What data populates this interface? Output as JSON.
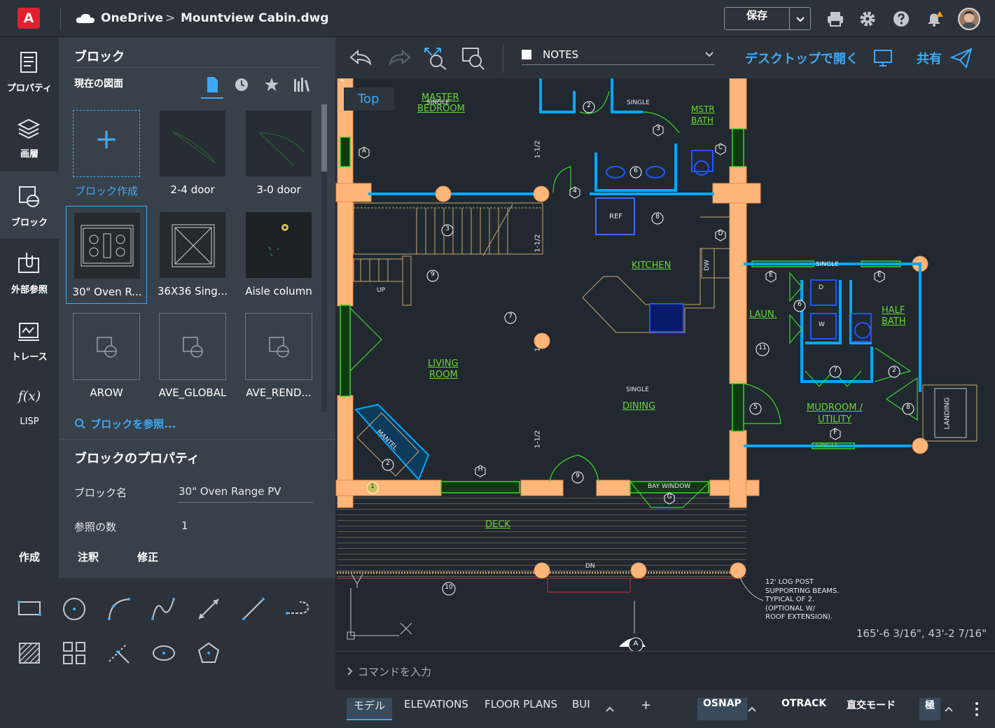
{
  "app": {
    "logo_letter": "A"
  },
  "header": {
    "cloud_name": "OneDrive",
    "separator": ">",
    "file_name": "Mountview Cabin.dwg",
    "save_label": "保存"
  },
  "left_rail": {
    "items": [
      {
        "label": "プロパティ"
      },
      {
        "label": "画層"
      },
      {
        "label": "ブロック"
      },
      {
        "label": "外部参照"
      },
      {
        "label": "トレース"
      },
      {
        "label": "LISP",
        "glyph": "f(x)"
      }
    ]
  },
  "blocks_panel": {
    "title": "ブロック",
    "subtitle": "現在の図面",
    "tiles": [
      {
        "label": "ブロック作成",
        "icon": "+"
      },
      {
        "label": "2-4 door"
      },
      {
        "label": "3-0 door"
      },
      {
        "label": "30\" Oven R..."
      },
      {
        "label": "36X36 Sing..."
      },
      {
        "label": "Aisle column"
      },
      {
        "label": "AROW"
      },
      {
        "label": "AVE_GLOBAL"
      },
      {
        "label": "AVE_REND..."
      }
    ],
    "browse_label": "ブロックを参照...",
    "properties_title": "ブロックのプロパティ",
    "block_name_label": "ブロック名",
    "block_name_value": "30\" Oven Range PV",
    "ref_count_label": "参照の数",
    "ref_count_value": "1"
  },
  "tools": {
    "tabs": [
      "作成",
      "注釈",
      "修正"
    ]
  },
  "toolbar": {
    "layer_name": "NOTES",
    "open_desktop": "デスクトップで開く",
    "share": "共有"
  },
  "canvas": {
    "view_label": "Top",
    "coords": "165'-6 3/16\", 43'-2 7/16\"",
    "viewcube_number": "1",
    "labels": [
      {
        "text": "MASTER",
        "cls": "g"
      },
      {
        "text": "BEDROOM",
        "cls": "g"
      },
      {
        "text": "MSTR",
        "cls": "g"
      },
      {
        "text": "BATH",
        "cls": "g"
      },
      {
        "text": "KITCHEN",
        "cls": "g"
      },
      {
        "text": "LAUN.",
        "cls": "g"
      },
      {
        "text": "HALF",
        "cls": "g"
      },
      {
        "text": "BATH",
        "cls": "g"
      },
      {
        "text": "LIVING",
        "cls": "g"
      },
      {
        "text": "ROOM",
        "cls": "g"
      },
      {
        "text": "DINING",
        "cls": "g"
      },
      {
        "text": "MUDROOM /",
        "cls": "g"
      },
      {
        "text": "UTILITY",
        "cls": "g"
      },
      {
        "text": "DECK",
        "cls": "g"
      },
      {
        "text": "SINGLE",
        "cls": "w"
      },
      {
        "text": "SINGLE",
        "cls": "w"
      },
      {
        "text": "SINGLE",
        "cls": "w"
      },
      {
        "text": "SINGLE",
        "cls": "w"
      },
      {
        "text": "SINGLE",
        "cls": "w"
      },
      {
        "text": "REF",
        "cls": "w"
      },
      {
        "text": "DW",
        "cls": "w"
      },
      {
        "text": "UP",
        "cls": "w"
      },
      {
        "text": "DN",
        "cls": "w"
      },
      {
        "text": "BAY WINDOW",
        "cls": "w"
      },
      {
        "text": "MANTEL",
        "cls": "w"
      },
      {
        "text": "LANDING",
        "cls": "w"
      },
      {
        "text": "1-1/2",
        "cls": "w"
      },
      {
        "text": "1-1/2",
        "cls": "w"
      },
      {
        "text": "1-1/2",
        "cls": "w"
      },
      {
        "text": "1-",
        "cls": "w"
      },
      {
        "text": "D",
        "cls": "w"
      },
      {
        "text": "W",
        "cls": "w"
      }
    ],
    "tags_hex": [
      "A",
      "C",
      "D",
      "E",
      "E",
      "F",
      "G",
      "H",
      "4",
      "3"
    ],
    "tags_circle": [
      "2",
      "3",
      "6",
      "8",
      "9",
      "7",
      "5",
      "6",
      "11",
      "7",
      "2",
      "8",
      "9",
      "10",
      "2",
      "1",
      "A"
    ],
    "note_lines": [
      "12' LOG POST",
      "SUPPORTING BEAMS.",
      "TYPICAL OF 2.",
      "(OPTIONAL W/",
      "ROOF EXTENSION)."
    ]
  },
  "command": {
    "placeholder": "コマンドを入力"
  },
  "status": {
    "tabs": [
      "モデル",
      "ELEVATIONS",
      "FLOOR PLANS",
      "BUI"
    ],
    "add": "+",
    "osnap": "OSNAP",
    "otrack": "OTRACK",
    "ortho": "直交モード",
    "polar": "極"
  },
  "colors": {
    "accent": "#3fa9f5",
    "wall": "#ffb67a",
    "wall_blue": "#00a8ff",
    "label_green": "#6bd43b"
  }
}
